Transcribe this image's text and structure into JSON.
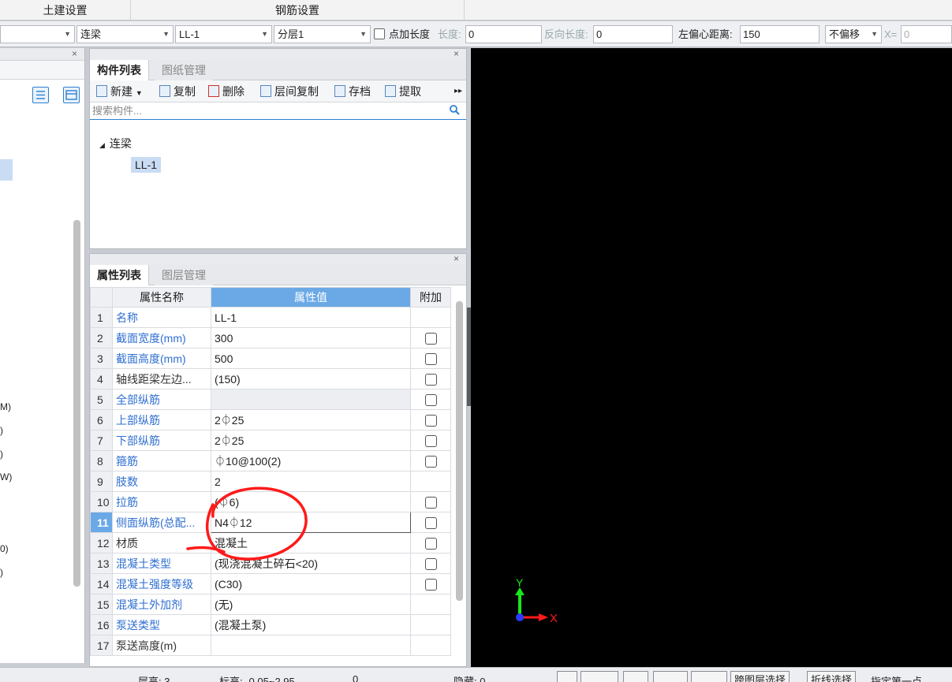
{
  "ribbon": {
    "tab_civil": "土建设置",
    "tab_rebar": "钢筋设置"
  },
  "propbar": {
    "combo_type": "连梁",
    "combo_name": "LL-1",
    "combo_layer": "分层1",
    "add_length_label": "点加长度",
    "length_label": "长度:",
    "length_value": "0",
    "reverse_length_label": "反向长度:",
    "reverse_length_value": "0",
    "offset_label": "左偏心距离:",
    "offset_value": "150",
    "shift_combo": "不偏移",
    "x_label": "X=",
    "x_value": "0"
  },
  "left_panel": {
    "fragments": [
      "M)",
      ")",
      ")",
      "W)",
      "0)",
      ")"
    ]
  },
  "component_panel": {
    "tab_component_list": "构件列表",
    "tab_drawing_manage": "图纸管理",
    "toolbar": {
      "new": "新建",
      "copy": "复制",
      "delete": "删除",
      "floor_copy": "层间复制",
      "archive": "存档",
      "extract": "提取"
    },
    "search_placeholder": "搜索构件...",
    "tree_root": "连梁",
    "tree_child": "LL-1"
  },
  "attr_panel": {
    "tab_attr_list": "属性列表",
    "tab_layer_manage": "图层管理",
    "headers": {
      "name": "属性名称",
      "value": "属性值",
      "extra": "附加"
    },
    "rows": [
      {
        "num": "1",
        "name": "名称",
        "value": "LL-1"
      },
      {
        "num": "2",
        "name": "截面宽度(mm)",
        "value": "300"
      },
      {
        "num": "3",
        "name": "截面高度(mm)",
        "value": "500"
      },
      {
        "num": "4",
        "name": "轴线距梁左边...",
        "value": "(150)"
      },
      {
        "num": "5",
        "name": "全部纵筋",
        "value": ""
      },
      {
        "num": "6",
        "name": "上部纵筋",
        "value": "2⏀25"
      },
      {
        "num": "7",
        "name": "下部纵筋",
        "value": "2⏀25"
      },
      {
        "num": "8",
        "name": "箍筋",
        "value": "⏀10@100(2)"
      },
      {
        "num": "9",
        "name": "肢数",
        "value": "2"
      },
      {
        "num": "10",
        "name": "拉筋",
        "value": "(⏀6)"
      },
      {
        "num": "11",
        "name": "侧面纵筋(总配...",
        "value": "N4⏀12"
      },
      {
        "num": "12",
        "name": "材质",
        "value": "混凝土"
      },
      {
        "num": "13",
        "name": "混凝土类型",
        "value": "(现浇混凝土碎石<20)"
      },
      {
        "num": "14",
        "name": "混凝土强度等级",
        "value": "(C30)"
      },
      {
        "num": "15",
        "name": "混凝土外加剂",
        "value": "(无)"
      },
      {
        "num": "16",
        "name": "泵送类型",
        "value": "(混凝土泵)"
      },
      {
        "num": "17",
        "name": "泵送高度(m)",
        "value": ""
      }
    ]
  },
  "canvas": {
    "axis_x": "X",
    "axis_y": "Y"
  },
  "statusbar": {
    "floor_height": "层高: 3",
    "elevation": "标高: -0.05~2.95",
    "count": "0",
    "hidden": "隐藏: 0",
    "cross_layer_select": "跨图层选择",
    "polyline_select": "折线选择",
    "specify_first_point": "指定第一点"
  },
  "colors": {
    "accent": "#6aa9e6",
    "link_blue": "#2f6fd0",
    "annotation_red": "#ff1a1a"
  }
}
